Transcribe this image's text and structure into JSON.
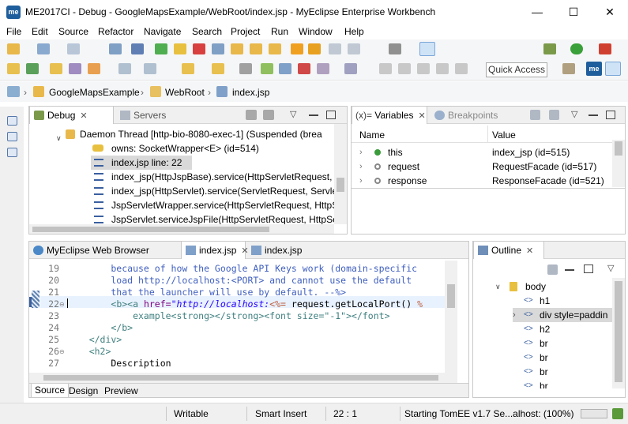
{
  "window": {
    "app_icon": "me",
    "title": "ME2017CI - Debug - GoogleMapsExample/WebRoot/index.jsp - MyEclipse Enterprise Workbench",
    "minimize_icon": "—",
    "maximize_icon": "☐",
    "close_icon": "✕"
  },
  "menu": [
    "File",
    "Edit",
    "Source",
    "Refactor",
    "Navigate",
    "Search",
    "Project",
    "Run",
    "Window",
    "Help"
  ],
  "toolbar": {
    "quick_access": "Quick Access",
    "perspective_me": "me"
  },
  "breadcrumb": [
    "GoogleMapsExample",
    "WebRoot",
    "index.jsp"
  ],
  "debug_view": {
    "tabs": [
      "Debug",
      "Servers"
    ],
    "rows": [
      "Daemon Thread [http-bio-8080-exec-1] (Suspended (brea",
      "owns: SocketWrapper<E>  (id=514)",
      "index.jsp line: 22",
      "index_jsp(HttpJspBase).service(HttpServletRequest, H",
      "index_jsp(HttpServlet).service(ServletRequest, ServletF",
      "JspServletWrapper.service(HttpServletRequest, HttpSe",
      "JspServlet.serviceJspFile(HttpServletRequest, HttpServ"
    ]
  },
  "variables_view": {
    "tabs": [
      "Variables",
      "Breakpoints"
    ],
    "tab_prefix": "(x)=",
    "columns": [
      "Name",
      "Value"
    ],
    "rows": [
      {
        "name": "this",
        "value": "index_jsp  (id=515)",
        "color": "#3a9b3a"
      },
      {
        "name": "request",
        "value": "RequestFacade  (id=517)",
        "color": "#888888"
      },
      {
        "name": "response",
        "value": "ResponseFacade  (id=521)",
        "color": "#888888"
      }
    ]
  },
  "editor": {
    "tabs": [
      "MyEclipse Web Browser",
      "index.jsp",
      "index.jsp"
    ],
    "line_numbers": [
      "19",
      "20",
      "21",
      "22",
      "23",
      "24",
      "25",
      "26",
      "27"
    ],
    "lines": [
      "        because of how the Google API Keys work (domain-specific",
      "        load http://localhost:<PORT> and cannot use the default ",
      "        that the launcher will use by default. --%>",
      "",
      "            example<strong></strong><font size=\"-1\"></font>",
      "        </b>",
      "    </div>",
      "    <h2>",
      "        Description"
    ],
    "line22": {
      "indent": "        ",
      "b_open": "<b>",
      "a_open": "<a ",
      "attr": "href=",
      "str": "\"http://localhost:",
      "jsp_open": "<%=",
      "expr": " request.getLocalPort() ",
      "jsp_close": "%"
    },
    "bottom_tabs": [
      "Source",
      "Design",
      "Preview"
    ]
  },
  "outline": {
    "tab": "Outline",
    "items": [
      "body",
      "h1",
      "div style=paddin",
      "h2",
      "br",
      "br",
      "br",
      "br"
    ]
  },
  "status": {
    "mode": "Writable",
    "insert": "Smart Insert",
    "position": "22 : 1",
    "progress_text": "Starting TomEE v1.7 Se...alhost: (100%)"
  }
}
